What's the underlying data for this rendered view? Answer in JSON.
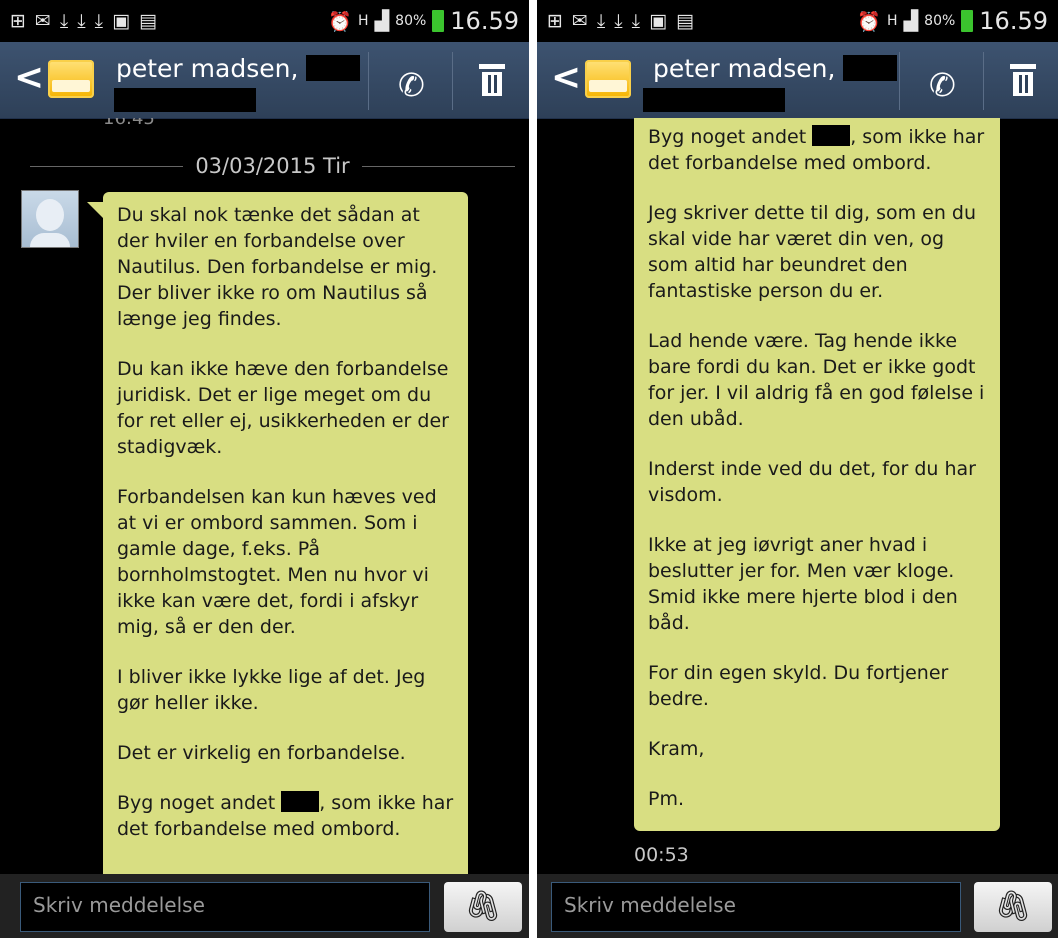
{
  "status_bar": {
    "battery": "80%",
    "time": "16.59",
    "network": "H"
  },
  "header": {
    "contact_name": "peter madsen,"
  },
  "compose": {
    "placeholder": "Skriv meddelelse"
  },
  "left_panel": {
    "date_separator": "03/03/2015 Tir",
    "message_paragraphs": [
      "Du skal nok tænke det sådan at der hviler en forbandelse over Nautilus. Den forbandelse er mig. Der bliver ikke ro om Nautilus så længe jeg findes.",
      "Du kan ikke hæve den forbandelse juridisk. Det er lige meget om du for ret eller ej, usikkerheden er der stadigvæk.",
      "Forbandelsen kan kun hæves ved at vi er ombord sammen. Som i gamle dage, f.eks. På bornholmstogtet. Men nu hvor vi ikke kan være det, fordi i afskyr mig, så er den der.",
      "I bliver ikke lykke lige af det. Jeg gør heller ikke.",
      "Det er virkelig en forbandelse."
    ],
    "last_paragraph_a": "Byg noget andet",
    "last_paragraph_b": ", som ikke har det forbandelse med ombord."
  },
  "right_panel": {
    "first_paragraph_a": "Byg noget andet",
    "first_paragraph_b": ", som ikke har det forbandelse med ombord.",
    "message_paragraphs": [
      "Jeg skriver dette til dig, som en du skal vide har været din ven, og som altid har beundret den fantastiske person du er.",
      "Lad hende være. Tag hende ikke bare fordi du kan. Det er ikke godt for jer. I vil aldrig få en god følelse i den ubåd.",
      "Inderst inde ved du det, for du har visdom.",
      "Ikke at jeg iøvrigt aner hvad i beslutter jer for. Men vær kloge. Smid ikke mere hjerte blod i den båd.",
      "For din egen skyld. Du fortjener bedre.",
      "Kram,",
      "Pm."
    ],
    "timestamp": "00:53"
  }
}
